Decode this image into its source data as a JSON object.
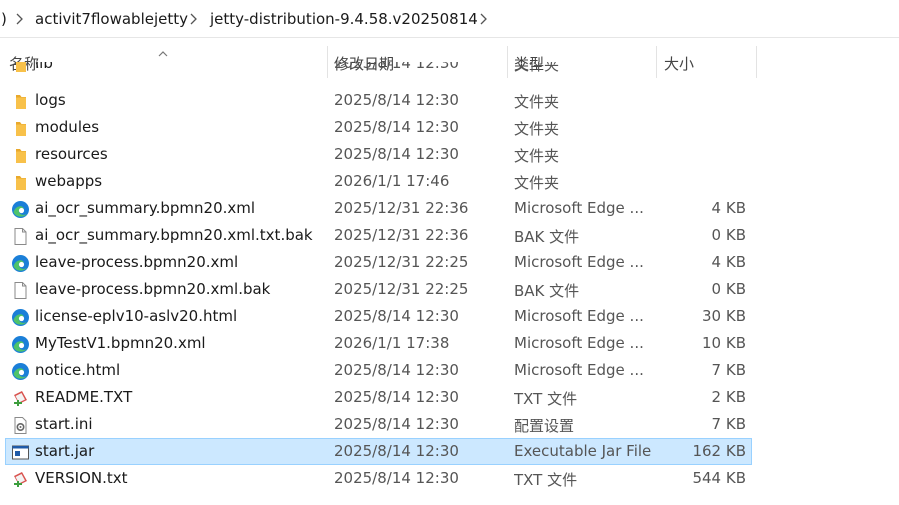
{
  "breadcrumb": {
    "items": [
      ":)",
      "activit7flowablejetty",
      "jetty-distribution-9.4.58.v20250814"
    ]
  },
  "columns": {
    "name": "名称",
    "date": "修改日期",
    "type": "类型",
    "size": "大小"
  },
  "files": [
    {
      "icon": "folder-icon",
      "name": "lib",
      "date": "2025/8/14 12:30",
      "type": "文件夹",
      "size": ""
    },
    {
      "icon": "folder-icon",
      "name": "logs",
      "date": "2025/8/14 12:30",
      "type": "文件夹",
      "size": ""
    },
    {
      "icon": "folder-icon",
      "name": "modules",
      "date": "2025/8/14 12:30",
      "type": "文件夹",
      "size": ""
    },
    {
      "icon": "folder-icon",
      "name": "resources",
      "date": "2025/8/14 12:30",
      "type": "文件夹",
      "size": ""
    },
    {
      "icon": "folder-icon",
      "name": "webapps",
      "date": "2026/1/1 17:46",
      "type": "文件夹",
      "size": ""
    },
    {
      "icon": "edge-icon",
      "name": "ai_ocr_summary.bpmn20.xml",
      "date": "2025/12/31 22:36",
      "type": "Microsoft Edge ...",
      "size": "4 KB"
    },
    {
      "icon": "blank-file-icon",
      "name": "ai_ocr_summary.bpmn20.xml.txt.bak",
      "date": "2025/12/31 22:36",
      "type": "BAK 文件",
      "size": "0 KB"
    },
    {
      "icon": "edge-icon",
      "name": "leave-process.bpmn20.xml",
      "date": "2025/12/31 22:25",
      "type": "Microsoft Edge ...",
      "size": "4 KB"
    },
    {
      "icon": "blank-file-icon",
      "name": "leave-process.bpmn20.xml.bak",
      "date": "2025/12/31 22:25",
      "type": "BAK 文件",
      "size": "0 KB"
    },
    {
      "icon": "edge-icon",
      "name": "license-eplv10-aslv20.html",
      "date": "2025/8/14 12:30",
      "type": "Microsoft Edge ...",
      "size": "30 KB"
    },
    {
      "icon": "edge-icon",
      "name": "MyTestV1.bpmn20.xml",
      "date": "2026/1/1 17:38",
      "type": "Microsoft Edge ...",
      "size": "10 KB"
    },
    {
      "icon": "edge-icon",
      "name": "notice.html",
      "date": "2025/8/14 12:30",
      "type": "Microsoft Edge ...",
      "size": "7 KB"
    },
    {
      "icon": "txt-editor-icon",
      "name": "README.TXT",
      "date": "2025/8/14 12:30",
      "type": "TXT 文件",
      "size": "2 KB"
    },
    {
      "icon": "settings-file-icon",
      "name": "start.ini",
      "date": "2025/8/14 12:30",
      "type": "配置设置",
      "size": "7 KB"
    },
    {
      "icon": "jar-file-icon",
      "name": "start.jar",
      "date": "2025/8/14 12:30",
      "type": "Executable Jar File",
      "size": "162 KB",
      "selected": true
    },
    {
      "icon": "txt-editor-icon",
      "name": "VERSION.txt",
      "date": "2025/8/14 12:30",
      "type": "TXT 文件",
      "size": "544 KB"
    }
  ],
  "colors": {
    "selection_bg": "#cce8ff",
    "selection_border": "#99d1ff",
    "folder": "#f8c14a",
    "edge_blue": "#1b7fd8",
    "edge_green": "#4fc36b"
  }
}
